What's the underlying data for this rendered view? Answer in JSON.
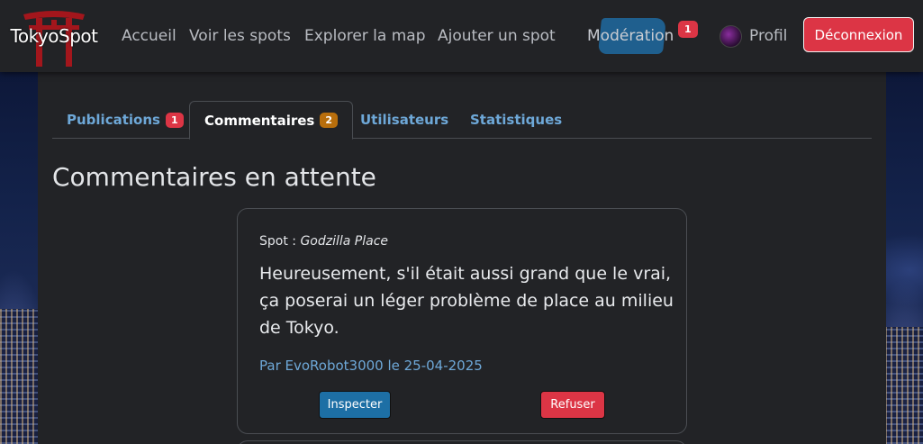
{
  "navbar": {
    "brand": "TokyoSpot",
    "links": [
      "Accueil",
      "Voir les spots",
      "Explorer la map",
      "Ajouter un spot"
    ],
    "moderation_label": "Modération",
    "moderation_badge": "1",
    "profile_label": "Profil",
    "logout_label": "Déconnexion"
  },
  "tabs": [
    {
      "label": "Publications",
      "badge": "1",
      "active": false
    },
    {
      "label": "Commentaires",
      "badge": "2",
      "active": true
    },
    {
      "label": "Utilisateurs",
      "badge": null,
      "active": false
    },
    {
      "label": "Statistiques",
      "badge": null,
      "active": false
    }
  ],
  "page_title": "Commentaires en attente",
  "comment": {
    "spot_prefix": "Spot :",
    "spot_name": "Godzilla Place",
    "text": "Heureusement, s'il était aussi grand que le vrai, ça poserai un léger problème de place au milieu de Tokyo.",
    "author_line": "Par EvoRobot3000 le 25-04-2025",
    "inspect_label": "Inspecter",
    "refuse_label": "Refuser"
  },
  "colors": {
    "navbar_bg": "#222326",
    "danger": "#dc3545",
    "primary": "#1d6fa5",
    "link": "#6ea8d8",
    "warning": "#b86e0c"
  }
}
